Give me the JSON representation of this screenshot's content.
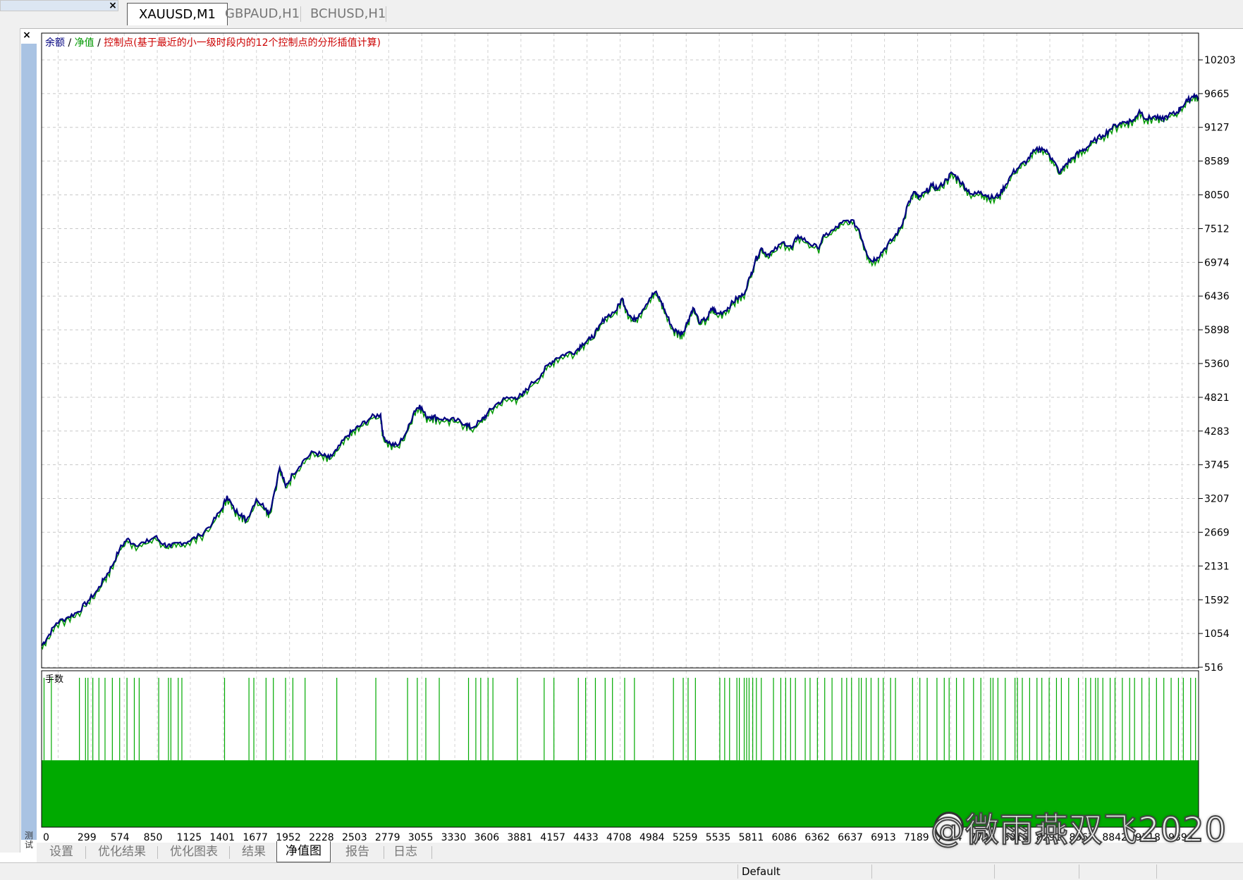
{
  "chart_tabs": [
    {
      "label": "XAUUSD,M1",
      "active": true
    },
    {
      "label": "GBPAUD,H1",
      "active": false
    },
    {
      "label": "BCHUSD,H1",
      "active": false
    }
  ],
  "close_glyph": "×",
  "side_strip_label": "测试",
  "chart_data": {
    "type": "line",
    "legend": {
      "balance": "余额",
      "sep1": " / ",
      "equity": "净值",
      "sep2": " / ",
      "note": "控制点(基于最近的小一级时段内的12个控制点的分形插值计算)"
    },
    "y_ticks": [
      10203,
      9665,
      9127,
      8589,
      8050,
      7512,
      6974,
      6436,
      5898,
      5360,
      4821,
      4283,
      3745,
      3207,
      2669,
      2131,
      1592,
      1054,
      516
    ],
    "ylim": [
      516,
      10203
    ],
    "x_ticks": [
      "0",
      "299",
      "574",
      "850",
      "1125",
      "1401",
      "1677",
      "1952",
      "2228",
      "2503",
      "2779",
      "3055",
      "3330",
      "3606",
      "3881",
      "4157",
      "4433",
      "4708",
      "4984",
      "5259",
      "5535",
      "5811",
      "6086",
      "6362",
      "6637",
      "6913",
      "7189",
      "7464",
      "7740",
      "8016",
      "8291",
      "8567",
      "8842",
      "9118",
      "9394"
    ],
    "xlim": [
      0,
      9485
    ],
    "series": [
      {
        "name": "余额",
        "color": "#000080",
        "values": [
          [
            0,
            860
          ],
          [
            50,
            1000
          ],
          [
            120,
            1220
          ],
          [
            220,
            1320
          ],
          [
            299,
            1400
          ],
          [
            380,
            1570
          ],
          [
            460,
            1750
          ],
          [
            520,
            1950
          ],
          [
            574,
            2120
          ],
          [
            640,
            2400
          ],
          [
            700,
            2560
          ],
          [
            760,
            2480
          ],
          [
            850,
            2500
          ],
          [
            930,
            2600
          ],
          [
            1000,
            2480
          ],
          [
            1060,
            2440
          ],
          [
            1125,
            2500
          ],
          [
            1200,
            2520
          ],
          [
            1300,
            2620
          ],
          [
            1401,
            2820
          ],
          [
            1480,
            3050
          ],
          [
            1520,
            3250
          ],
          [
            1580,
            3020
          ],
          [
            1640,
            2960
          ],
          [
            1677,
            2850
          ],
          [
            1760,
            3200
          ],
          [
            1840,
            3050
          ],
          [
            1870,
            2980
          ],
          [
            1952,
            3700
          ],
          [
            2000,
            3400
          ],
          [
            2060,
            3600
          ],
          [
            2140,
            3800
          ],
          [
            2228,
            3950
          ],
          [
            2300,
            3900
          ],
          [
            2360,
            3850
          ],
          [
            2420,
            3980
          ],
          [
            2503,
            4200
          ],
          [
            2560,
            4300
          ],
          [
            2620,
            4380
          ],
          [
            2700,
            4500
          ],
          [
            2779,
            4550
          ],
          [
            2800,
            4200
          ],
          [
            2860,
            4080
          ],
          [
            2920,
            4050
          ],
          [
            3000,
            4300
          ],
          [
            3055,
            4600
          ],
          [
            3100,
            4700
          ],
          [
            3150,
            4520
          ],
          [
            3200,
            4520
          ],
          [
            3250,
            4490
          ],
          [
            3330,
            4470
          ],
          [
            3400,
            4450
          ],
          [
            3480,
            4400
          ],
          [
            3520,
            4330
          ],
          [
            3606,
            4450
          ],
          [
            3650,
            4550
          ],
          [
            3720,
            4700
          ],
          [
            3800,
            4800
          ],
          [
            3881,
            4820
          ],
          [
            3940,
            4850
          ],
          [
            4000,
            5000
          ],
          [
            4100,
            5200
          ],
          [
            4157,
            5350
          ],
          [
            4220,
            5450
          ],
          [
            4300,
            5520
          ],
          [
            4380,
            5560
          ],
          [
            4433,
            5680
          ],
          [
            4500,
            5750
          ],
          [
            4560,
            5900
          ],
          [
            4620,
            6100
          ],
          [
            4708,
            6200
          ],
          [
            4760,
            6400
          ],
          [
            4800,
            6200
          ],
          [
            4850,
            6050
          ],
          [
            4900,
            6150
          ],
          [
            4984,
            6400
          ],
          [
            5030,
            6500
          ],
          [
            5080,
            6350
          ],
          [
            5120,
            6150
          ],
          [
            5180,
            5900
          ],
          [
            5230,
            5850
          ],
          [
            5259,
            5860
          ],
          [
            5300,
            6050
          ],
          [
            5340,
            6250
          ],
          [
            5400,
            6000
          ],
          [
            5460,
            6100
          ],
          [
            5500,
            6250
          ],
          [
            5535,
            6150
          ],
          [
            5600,
            6200
          ],
          [
            5650,
            6300
          ],
          [
            5700,
            6400
          ],
          [
            5750,
            6450
          ],
          [
            5811,
            6750
          ],
          [
            5850,
            7000
          ],
          [
            5900,
            7200
          ],
          [
            5950,
            7100
          ],
          [
            6000,
            7150
          ],
          [
            6086,
            7300
          ],
          [
            6150,
            7200
          ],
          [
            6200,
            7400
          ],
          [
            6280,
            7300
          ],
          [
            6362,
            7200
          ],
          [
            6420,
            7400
          ],
          [
            6500,
            7500
          ],
          [
            6560,
            7600
          ],
          [
            6637,
            7650
          ],
          [
            6700,
            7500
          ],
          [
            6760,
            7150
          ],
          [
            6800,
            7000
          ],
          [
            6850,
            7050
          ],
          [
            6913,
            7200
          ],
          [
            6980,
            7350
          ],
          [
            7050,
            7550
          ],
          [
            7100,
            7900
          ],
          [
            7160,
            8100
          ],
          [
            7189,
            8000
          ],
          [
            7250,
            8100
          ],
          [
            7300,
            8200
          ],
          [
            7350,
            8150
          ],
          [
            7420,
            8300
          ],
          [
            7464,
            8400
          ],
          [
            7520,
            8300
          ],
          [
            7580,
            8150
          ],
          [
            7640,
            8050
          ],
          [
            7700,
            8100
          ],
          [
            7740,
            8050
          ],
          [
            7800,
            8000
          ],
          [
            7850,
            8050
          ],
          [
            7900,
            8200
          ],
          [
            7960,
            8400
          ],
          [
            8016,
            8500
          ],
          [
            8080,
            8600
          ],
          [
            8140,
            8750
          ],
          [
            8200,
            8800
          ],
          [
            8260,
            8700
          ],
          [
            8291,
            8600
          ],
          [
            8350,
            8400
          ],
          [
            8400,
            8550
          ],
          [
            8460,
            8650
          ],
          [
            8520,
            8750
          ],
          [
            8567,
            8800
          ],
          [
            8620,
            8900
          ],
          [
            8700,
            9000
          ],
          [
            8760,
            9100
          ],
          [
            8842,
            9200
          ],
          [
            8900,
            9220
          ],
          [
            8960,
            9250
          ],
          [
            9000,
            9400
          ],
          [
            9060,
            9260
          ],
          [
            9118,
            9300
          ],
          [
            9180,
            9250
          ],
          [
            9240,
            9320
          ],
          [
            9300,
            9350
          ],
          [
            9340,
            9450
          ],
          [
            9394,
            9550
          ],
          [
            9450,
            9650
          ],
          [
            9485,
            9600
          ]
        ]
      },
      {
        "name": "净值",
        "color": "#009900"
      }
    ],
    "lots_panel": {
      "label": "手数",
      "color": "#00aa00",
      "base_fraction": 0.45,
      "spike_xs": [
        20,
        80,
        310,
        360,
        380,
        420,
        470,
        520,
        580,
        640,
        700,
        760,
        800,
        960,
        1040,
        1060,
        1120,
        1150,
        1500,
        1700,
        1740,
        1840,
        1900,
        2000,
        2060,
        2160,
        2420,
        2740,
        3000,
        3080,
        3150,
        3260,
        3500,
        3560,
        3600,
        3660,
        3700,
        3900,
        4120,
        4200,
        4400,
        4460,
        4540,
        4620,
        4680,
        4780,
        4860,
        5180,
        5260,
        5300,
        5360,
        5560,
        5600,
        5640,
        5700,
        5720,
        5760,
        5780,
        5800,
        5830,
        5860,
        5900,
        6000,
        6060,
        6100,
        6140,
        6180,
        6260,
        6300,
        6360,
        6420,
        6480,
        6560,
        6600,
        6640,
        6700,
        6720,
        6760,
        6800,
        6860,
        6900,
        6960,
        7000,
        7140,
        7200,
        7260,
        7340,
        7400,
        7440,
        7500,
        7560,
        7640,
        7700,
        7780,
        7800,
        7840,
        7900,
        7980,
        8000,
        8040,
        8100,
        8160,
        8200,
        8260,
        8320,
        8360,
        8420,
        8500,
        8560,
        8600,
        8640,
        8660,
        8700,
        8760,
        8800,
        8860,
        8920,
        8960,
        9020,
        9080,
        9140,
        9200,
        9260,
        9320,
        9360,
        9420,
        9460
      ]
    }
  },
  "bottom_tabs": [
    {
      "label": "设置",
      "active": false
    },
    {
      "label": "优化结果",
      "active": false
    },
    {
      "label": "优化图表",
      "active": false
    },
    {
      "label": "结果",
      "active": false
    },
    {
      "label": "净值图",
      "active": true
    },
    {
      "label": "报告",
      "active": false
    },
    {
      "label": "日志",
      "active": false
    }
  ],
  "status_text": "Default",
  "watermark": "@微雨燕双飞2020"
}
